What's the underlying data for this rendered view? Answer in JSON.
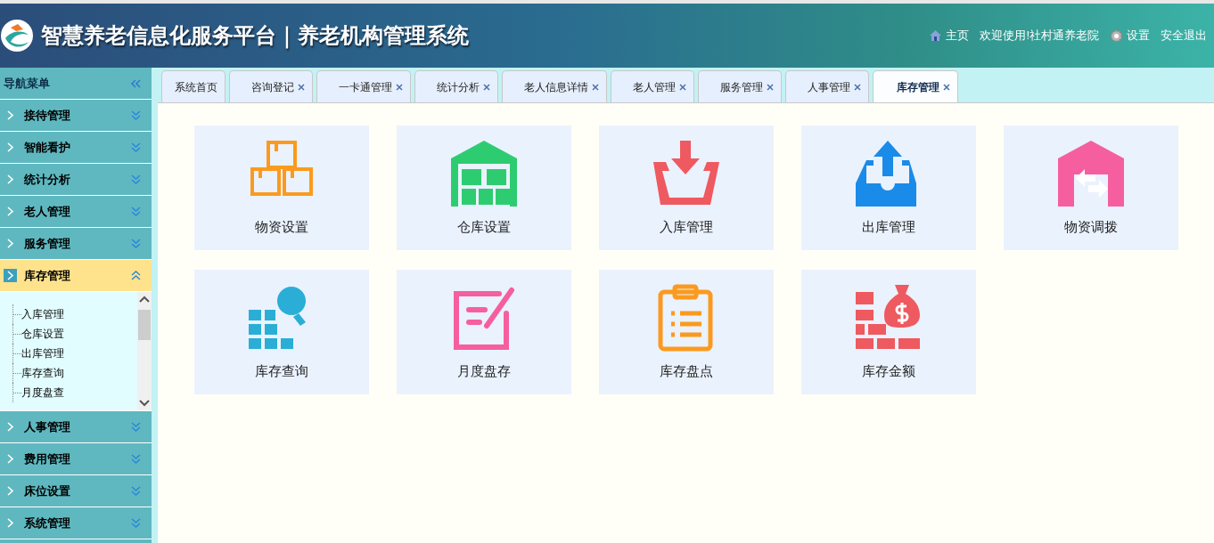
{
  "header": {
    "title": "智慧养老信息化服务平台｜养老机构管理系统",
    "links": [
      {
        "kind": "home",
        "label": "主页"
      },
      {
        "kind": "text",
        "label": "欢迎使用!社村通养老院"
      },
      {
        "kind": "settings",
        "label": "设置"
      },
      {
        "kind": "text",
        "label": "安全退出"
      }
    ]
  },
  "sidebar": {
    "title": "导航菜单",
    "items": [
      {
        "label": "接待管理",
        "expanded": false
      },
      {
        "label": "智能看护",
        "expanded": false
      },
      {
        "label": "统计分析",
        "expanded": false
      },
      {
        "label": "老人管理",
        "expanded": false
      },
      {
        "label": "服务管理",
        "expanded": false
      },
      {
        "label": "库存管理",
        "expanded": true,
        "children": [
          {
            "label": "入库管理"
          },
          {
            "label": "仓库设置"
          },
          {
            "label": "出库管理"
          },
          {
            "label": "库存查询"
          },
          {
            "label": "月度盘查"
          }
        ]
      },
      {
        "label": "人事管理",
        "expanded": false
      },
      {
        "label": "费用管理",
        "expanded": false
      },
      {
        "label": "床位设置",
        "expanded": false
      },
      {
        "label": "系统管理",
        "expanded": false
      }
    ]
  },
  "tabs": [
    {
      "label": "系统首页",
      "selected": false,
      "closable": false
    },
    {
      "label": "咨询登记",
      "selected": false,
      "closable": true
    },
    {
      "label": "一卡通管理",
      "selected": false,
      "closable": true
    },
    {
      "label": "统计分析",
      "selected": false,
      "closable": true
    },
    {
      "label": "老人信息详情",
      "selected": false,
      "closable": true
    },
    {
      "label": "老人管理",
      "selected": false,
      "closable": true
    },
    {
      "label": "服务管理",
      "selected": false,
      "closable": true
    },
    {
      "label": "人事管理",
      "selected": false,
      "closable": true
    },
    {
      "label": "库存管理",
      "selected": true,
      "closable": true
    }
  ],
  "tiles": [
    {
      "label": "物资设置",
      "kind": "boxes",
      "color": "#fb9a1e"
    },
    {
      "label": "仓库设置",
      "kind": "warehouse",
      "color": "#2ecc71"
    },
    {
      "label": "入库管理",
      "kind": "inbox-in",
      "color": "#ee5a5f"
    },
    {
      "label": "出库管理",
      "kind": "inbox-out",
      "color": "#1a8be8"
    },
    {
      "label": "物资调拨",
      "kind": "transfer",
      "color": "#f55fa0"
    },
    {
      "label": "库存查询",
      "kind": "search",
      "color": "#2aaed6"
    },
    {
      "label": "月度盘存",
      "kind": "edit",
      "color": "#f55fa0"
    },
    {
      "label": "库存盘点",
      "kind": "clipboard",
      "color": "#fb9a1e"
    },
    {
      "label": "库存金额",
      "kind": "money",
      "color": "#ee5a5f"
    }
  ]
}
